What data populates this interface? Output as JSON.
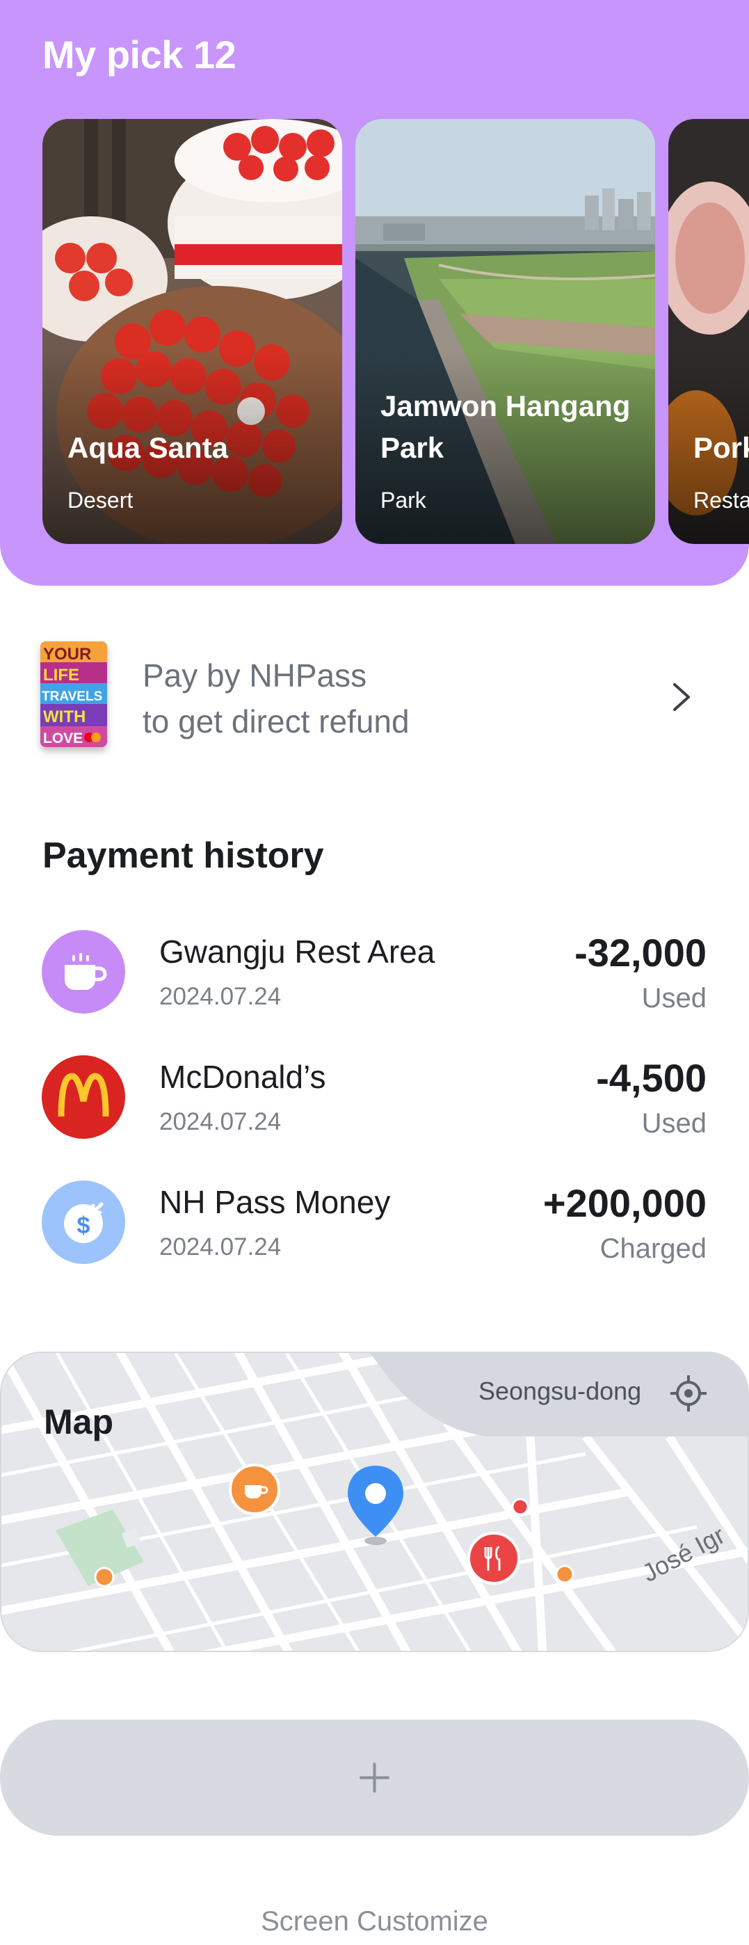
{
  "my_pick": {
    "title": "My pick 12",
    "cards": [
      {
        "name": "Aqua Santa",
        "category": "Desert"
      },
      {
        "name": "Jamwon Hangang Park",
        "category": "Park"
      },
      {
        "name": "Pork",
        "category": "Restaurant"
      }
    ]
  },
  "promo": {
    "card_art_text": [
      "YOUR",
      "LIFE",
      "TRAVELS",
      "WITH",
      "LOVE"
    ],
    "line1": "Pay by NHPass",
    "line2": "to get direct refund"
  },
  "payment_history": {
    "title": "Payment history",
    "items": [
      {
        "name": "Gwangju Rest Area",
        "date": "2024.07.24",
        "amount": "-32,000",
        "status": "Used",
        "icon": "cup-icon",
        "color": "#c78bf7"
      },
      {
        "name": "McDonald’s",
        "date": "2024.07.24",
        "amount": "-4,500",
        "status": "Used",
        "icon": "mcdonalds-logo-icon",
        "color": "#d92421"
      },
      {
        "name": "NH Pass Money",
        "date": "2024.07.24",
        "amount": "+200,000",
        "status": "Charged",
        "icon": "coin-charge-icon",
        "color": "#9cc3fb"
      }
    ]
  },
  "map": {
    "title": "Map",
    "area": "Seongsu-dong",
    "street_label": "José Igr"
  },
  "add_button": {
    "icon": "plus-icon"
  },
  "footer": {
    "customize": "Screen Customize"
  }
}
